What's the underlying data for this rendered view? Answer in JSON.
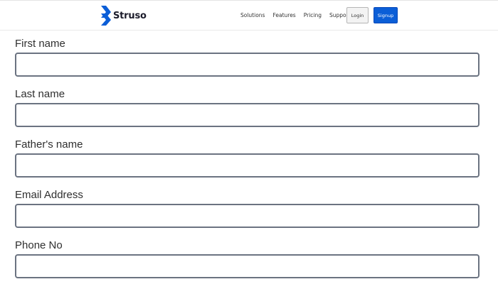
{
  "brand": {
    "name": "Struso",
    "logo_color": "#0b5ed7",
    "logo_icon": "stacked-chevron-s-logo"
  },
  "nav": {
    "links": [
      {
        "label": "Solutions"
      },
      {
        "label": "Features"
      },
      {
        "label": "Pricing"
      },
      {
        "label": "Support"
      }
    ],
    "login_label": "Login",
    "signup_label": "Signup",
    "signup_color": "#0b5ed7"
  },
  "form": {
    "fields": [
      {
        "label": "First name",
        "value": "",
        "placeholder": ""
      },
      {
        "label": "Last name",
        "value": "",
        "placeholder": ""
      },
      {
        "label": "Father's name",
        "value": "",
        "placeholder": ""
      },
      {
        "label": "Email Address",
        "value": "",
        "placeholder": ""
      },
      {
        "label": "Phone No",
        "value": "",
        "placeholder": ""
      }
    ]
  }
}
